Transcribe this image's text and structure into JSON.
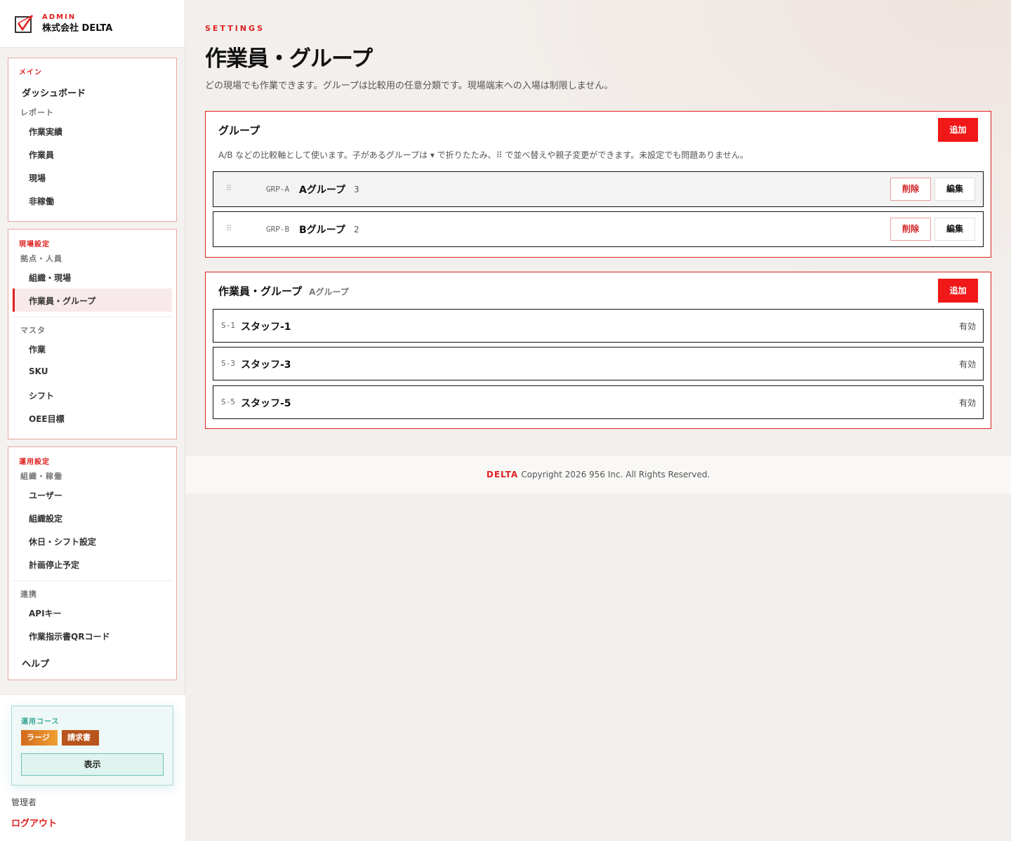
{
  "brand": {
    "kicker": "ADMIN",
    "name": "株式会社 DELTA"
  },
  "sidebar": {
    "main_section": {
      "title": "メイン",
      "dashboard": "ダッシュボード",
      "report_label": "レポート",
      "items": [
        "作業実績",
        "作業員",
        "現場",
        "非稼働"
      ]
    },
    "site_section": {
      "title": "現場設定",
      "group1_label": "拠点・人員",
      "group1_items": [
        "組織・現場",
        "作業員・グループ"
      ],
      "group2_label": "マスタ",
      "group2_items": [
        "作業",
        "SKU",
        "シフト",
        "OEE目標"
      ]
    },
    "ops_section": {
      "title": "運用設定",
      "group1_label": "組織・稼働",
      "group1_items": [
        "ユーザー",
        "組織設定",
        "休日・シフト設定",
        "計画停止予定"
      ],
      "group2_label": "連携",
      "group2_items": [
        "APIキー",
        "作業指示書QRコード"
      ],
      "help": "ヘルプ"
    }
  },
  "plan": {
    "label": "運用コース",
    "badges": [
      "ラージ",
      "請求書"
    ],
    "show_button": "表示"
  },
  "user": {
    "role": "管理者",
    "logout": "ログアウト"
  },
  "page": {
    "kicker": "SETTINGS",
    "title": "作業員・グループ",
    "description": "どの現場でも作業できます。グループは比較用の任意分類です。現場端末への入場は制限しません。"
  },
  "groups_panel": {
    "title": "グループ",
    "add_label": "追加",
    "help": "A/B などの比較軸として使います。子があるグループは ▾ で折りたたみ、⠿ で並べ替えや親子変更ができます。未設定でも問題ありません。",
    "rows": [
      {
        "code": "GRP-A",
        "name": "Aグループ",
        "count": "3"
      },
      {
        "code": "GRP-B",
        "name": "Bグループ",
        "count": "2"
      }
    ],
    "delete_label": "削除",
    "edit_label": "編集"
  },
  "members_panel": {
    "title": "作業員・グループ",
    "subtitle": "Aグループ",
    "add_label": "追加",
    "rows": [
      {
        "code": "S-1",
        "name": "スタッフ-1",
        "status": "有効"
      },
      {
        "code": "S-3",
        "name": "スタッフ-3",
        "status": "有効"
      },
      {
        "code": "S-5",
        "name": "スタッフ-5",
        "status": "有効"
      }
    ]
  },
  "footer": {
    "brand": "DELTA",
    "copyright": "Copyright 2026 956 Inc. All Rights Reserved."
  },
  "colors": {
    "accent": "#e02020",
    "teal": "#3aa89a"
  },
  "icons": {
    "logo": "checkbox-logo-icon",
    "grip": "drag-handle-icon"
  }
}
